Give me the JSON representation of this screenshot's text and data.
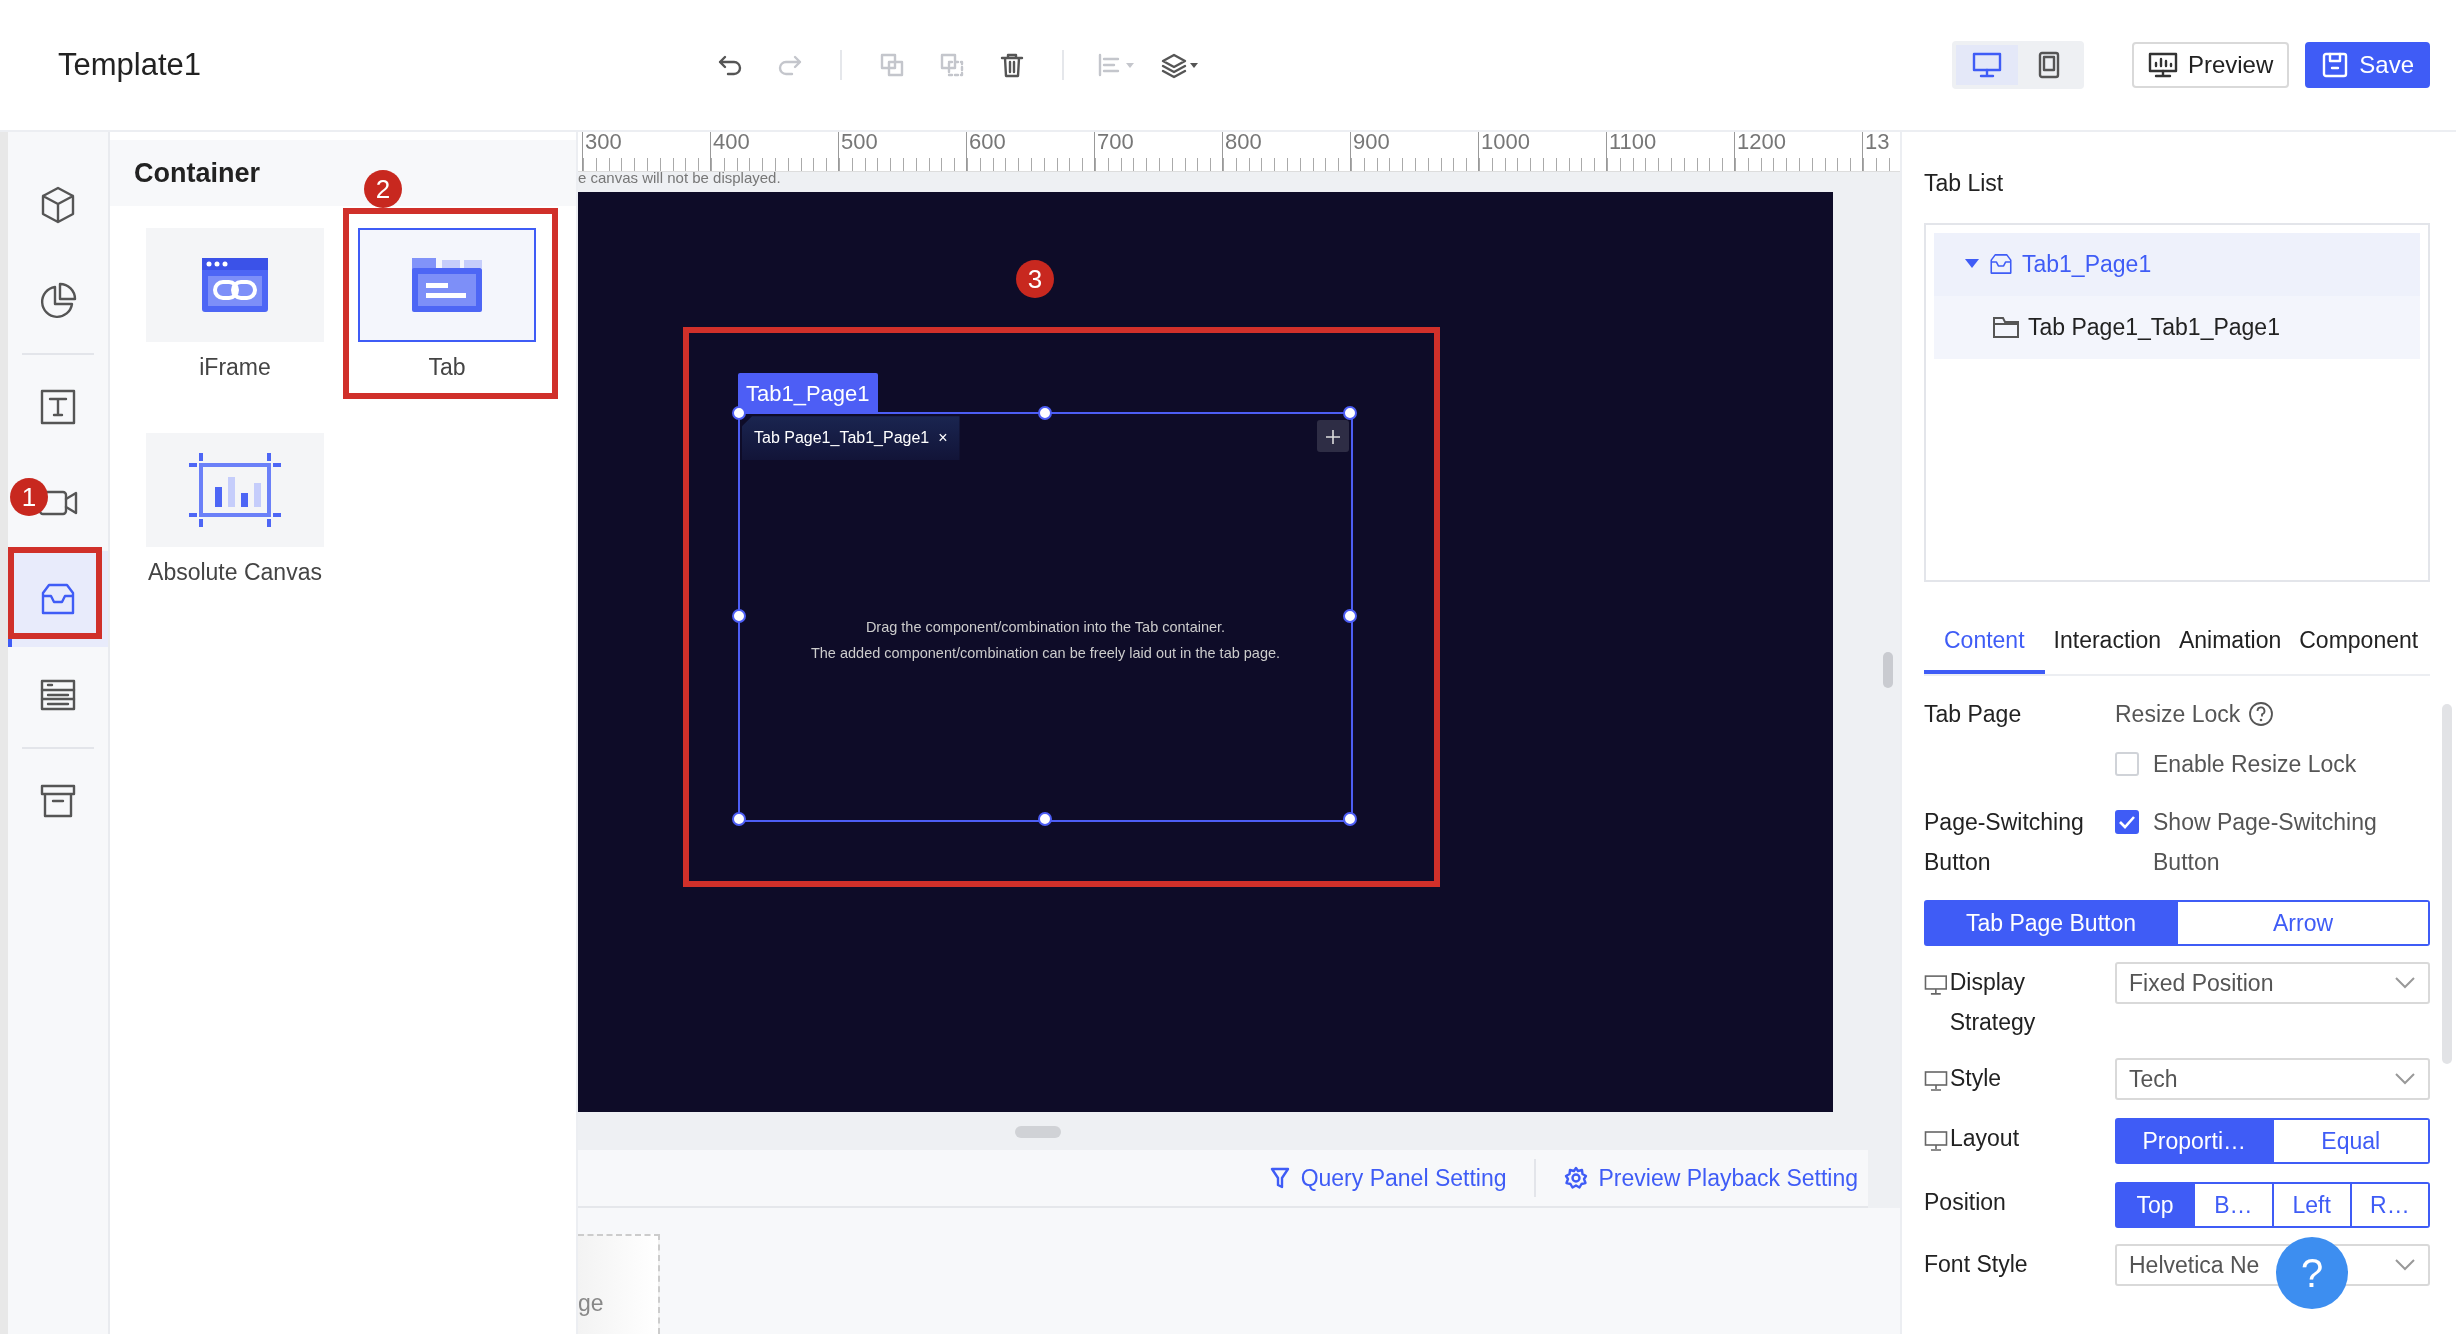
{
  "window": {
    "title": "Template1"
  },
  "toolbar": {
    "tools": [
      {
        "kind": "undo",
        "disabled": false
      },
      {
        "kind": "redo",
        "disabled": true
      },
      {
        "kind": "separator"
      },
      {
        "kind": "copy",
        "disabled": true
      },
      {
        "kind": "paste",
        "disabled": true
      },
      {
        "kind": "delete",
        "disabled": false
      },
      {
        "kind": "separator"
      },
      {
        "kind": "align",
        "disabled": true
      },
      {
        "kind": "layers",
        "disabled": false
      }
    ],
    "device_modes": [
      {
        "kind": "desktop",
        "selected": true
      },
      {
        "kind": "tablet",
        "selected": false
      }
    ],
    "actions": [
      {
        "kind": "preview",
        "label": "Preview"
      },
      {
        "kind": "save",
        "label": "Save"
      }
    ]
  },
  "sidebar": {
    "groups": [
      [
        {
          "kind": "cube",
          "selected": false
        },
        {
          "kind": "chart",
          "selected": false
        }
      ],
      [
        {
          "kind": "text",
          "selected": false
        },
        {
          "kind": "video",
          "selected": false
        },
        {
          "kind": "container",
          "selected": true
        },
        {
          "kind": "form",
          "selected": false
        }
      ],
      [
        {
          "kind": "archive",
          "selected": false
        }
      ]
    ]
  },
  "component_panel": {
    "title": "Container",
    "items": [
      {
        "kind": "iframe",
        "label": "iFrame",
        "selected": false
      },
      {
        "kind": "tab",
        "label": "Tab",
        "selected": true
      },
      {
        "kind": "canvas",
        "label": "Absolute Canvas",
        "selected": false
      }
    ]
  },
  "ruler": {
    "ticks": [
      "300",
      "400",
      "500",
      "600",
      "700",
      "800",
      "900",
      "1000",
      "1100",
      "1200",
      "13"
    ]
  },
  "canvas": {
    "notice": "e canvas will not be displayed.",
    "tab_component": {
      "name": "Tab1_Page1",
      "tabs": [
        {
          "label": "Tab Page1_Tab1_Page1",
          "close": "×",
          "selected": true
        }
      ],
      "hint_lines": [
        "Drag the component/combination into the Tab container.",
        "The added component/combination can be freely laid out in the tab page."
      ]
    }
  },
  "annotations": [
    {
      "label": "1"
    },
    {
      "label": "2"
    },
    {
      "label": "3"
    }
  ],
  "bottom_bar": {
    "links": [
      {
        "kind": "filter",
        "label": "Query Panel Setting"
      },
      {
        "kind": "gear",
        "label": "Preview Playback Setting"
      }
    ]
  },
  "lower_area": {
    "card_text": "ge"
  },
  "properties": {
    "tab_list_title": "Tab List",
    "tree": [
      {
        "kind": "tab",
        "label": "Tab1_Page1",
        "expanded": true,
        "selected": true,
        "children": [
          {
            "kind": "page",
            "label": "Tab Page1_Tab1_Page1",
            "selected": false
          }
        ]
      }
    ],
    "tabs": [
      {
        "label": "Content",
        "selected": true
      },
      {
        "label": "Interaction",
        "selected": false
      },
      {
        "label": "Animation",
        "selected": false
      },
      {
        "label": "Component",
        "selected": false
      }
    ],
    "rows": [
      {
        "kind": "checkbox",
        "label": "Tab Page",
        "title": "Resize Lock",
        "option": "Enable Resize Lock",
        "checked": false
      },
      {
        "kind": "checkbox",
        "label": "Page-Switching Button",
        "option": "Show Page-Switching Button",
        "checked": true
      },
      {
        "kind": "segmented",
        "options": [
          {
            "label": "Tab Page Button",
            "selected": true
          },
          {
            "label": "Arrow",
            "selected": false
          }
        ]
      },
      {
        "kind": "select",
        "label": "Display Strategy",
        "device_icon": true,
        "value": "Fixed Position"
      },
      {
        "kind": "select",
        "label": "Style",
        "device_icon": true,
        "value": "Tech"
      },
      {
        "kind": "segmented",
        "label": "Layout",
        "device_icon": true,
        "options": [
          {
            "label": "Proporti…",
            "selected": true
          },
          {
            "label": "Equal",
            "selected": false
          }
        ]
      },
      {
        "kind": "segmented",
        "label": "Position",
        "options": [
          {
            "label": "Top",
            "selected": true
          },
          {
            "label": "B…",
            "selected": false
          },
          {
            "label": "Left",
            "selected": false
          },
          {
            "label": "R…",
            "selected": false
          }
        ]
      },
      {
        "kind": "select",
        "label": "Font Style",
        "value": "Helvetica Ne"
      }
    ]
  },
  "help_button": {
    "label": "?"
  }
}
